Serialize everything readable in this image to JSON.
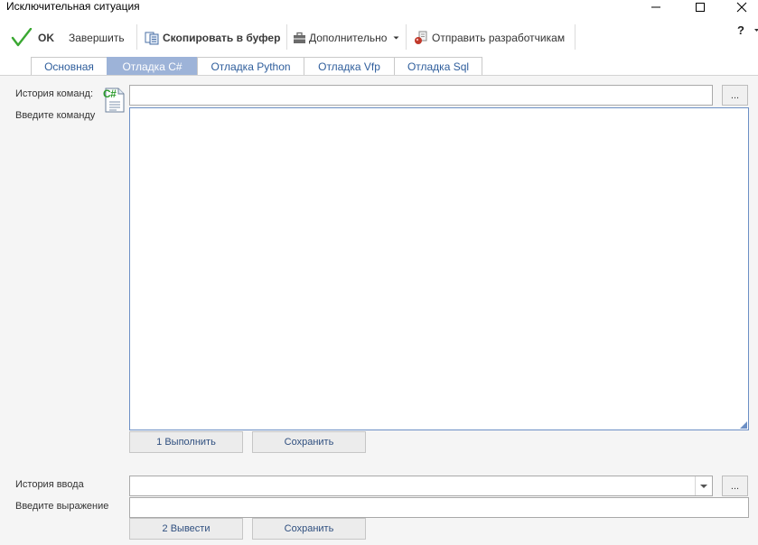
{
  "window": {
    "title": "Исключительная ситуация"
  },
  "toolbar": {
    "ok_label": "OK",
    "finish_label": "Завершить",
    "copy_label": "Скопировать в буфер",
    "more_label": "Дополнительно",
    "send_label": "Отправить разработчикам",
    "help_label": "?"
  },
  "tabs": [
    {
      "label": "Основная"
    },
    {
      "label": "Отладка C#"
    },
    {
      "label": "Отладка Python"
    },
    {
      "label": "Отладка Vfp"
    },
    {
      "label": "Отладка Sql"
    }
  ],
  "active_tab": "Отладка C#",
  "command": {
    "history_label": "История команд:",
    "history_value": "",
    "language_badge": "C#",
    "enter_label": "Введите команду",
    "command_value": "",
    "ellipsis": "...",
    "run_label": "1 Выполнить",
    "save_label": "Сохранить"
  },
  "expression": {
    "history_label": "История ввода",
    "history_value": "",
    "enter_label": "Введите выражение",
    "expression_value": "",
    "ellipsis": "...",
    "output_label": "2 Вывести",
    "save_label": "Сохранить"
  },
  "colors": {
    "active_tab_bg": "#9db3d8",
    "tab_text": "#2f5e9c",
    "ok_check": "#3aa832"
  }
}
